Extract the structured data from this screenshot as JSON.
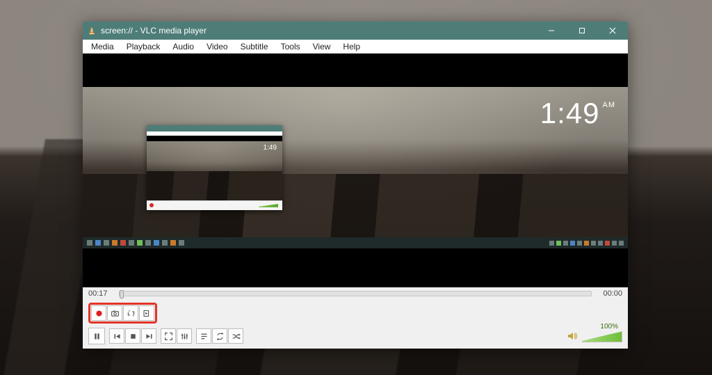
{
  "titlebar": {
    "title": "screen:// - VLC media player"
  },
  "menu": {
    "items": [
      "Media",
      "Playback",
      "Audio",
      "Video",
      "Subtitle",
      "Tools",
      "View",
      "Help"
    ]
  },
  "overlay": {
    "clock_time": "1:49",
    "clock_ampm": "AM",
    "mini_clock": "1:49"
  },
  "playback": {
    "elapsed": "00:17",
    "remaining": "00:00"
  },
  "volume": {
    "percent_label": "100%"
  },
  "icons": {
    "minimize": "minimize-icon",
    "maximize": "maximize-icon",
    "close": "close-icon",
    "record": "record-icon",
    "snapshot": "snapshot-icon",
    "loop_ab": "loop-ab-icon",
    "frame_step": "frame-step-icon",
    "pause": "pause-icon",
    "prev": "previous-icon",
    "stop": "stop-icon",
    "next": "next-icon",
    "fullscreen": "fullscreen-icon",
    "ext_settings": "extended-settings-icon",
    "playlist": "playlist-icon",
    "loop": "loop-icon",
    "shuffle": "shuffle-icon",
    "speaker": "speaker-icon"
  }
}
